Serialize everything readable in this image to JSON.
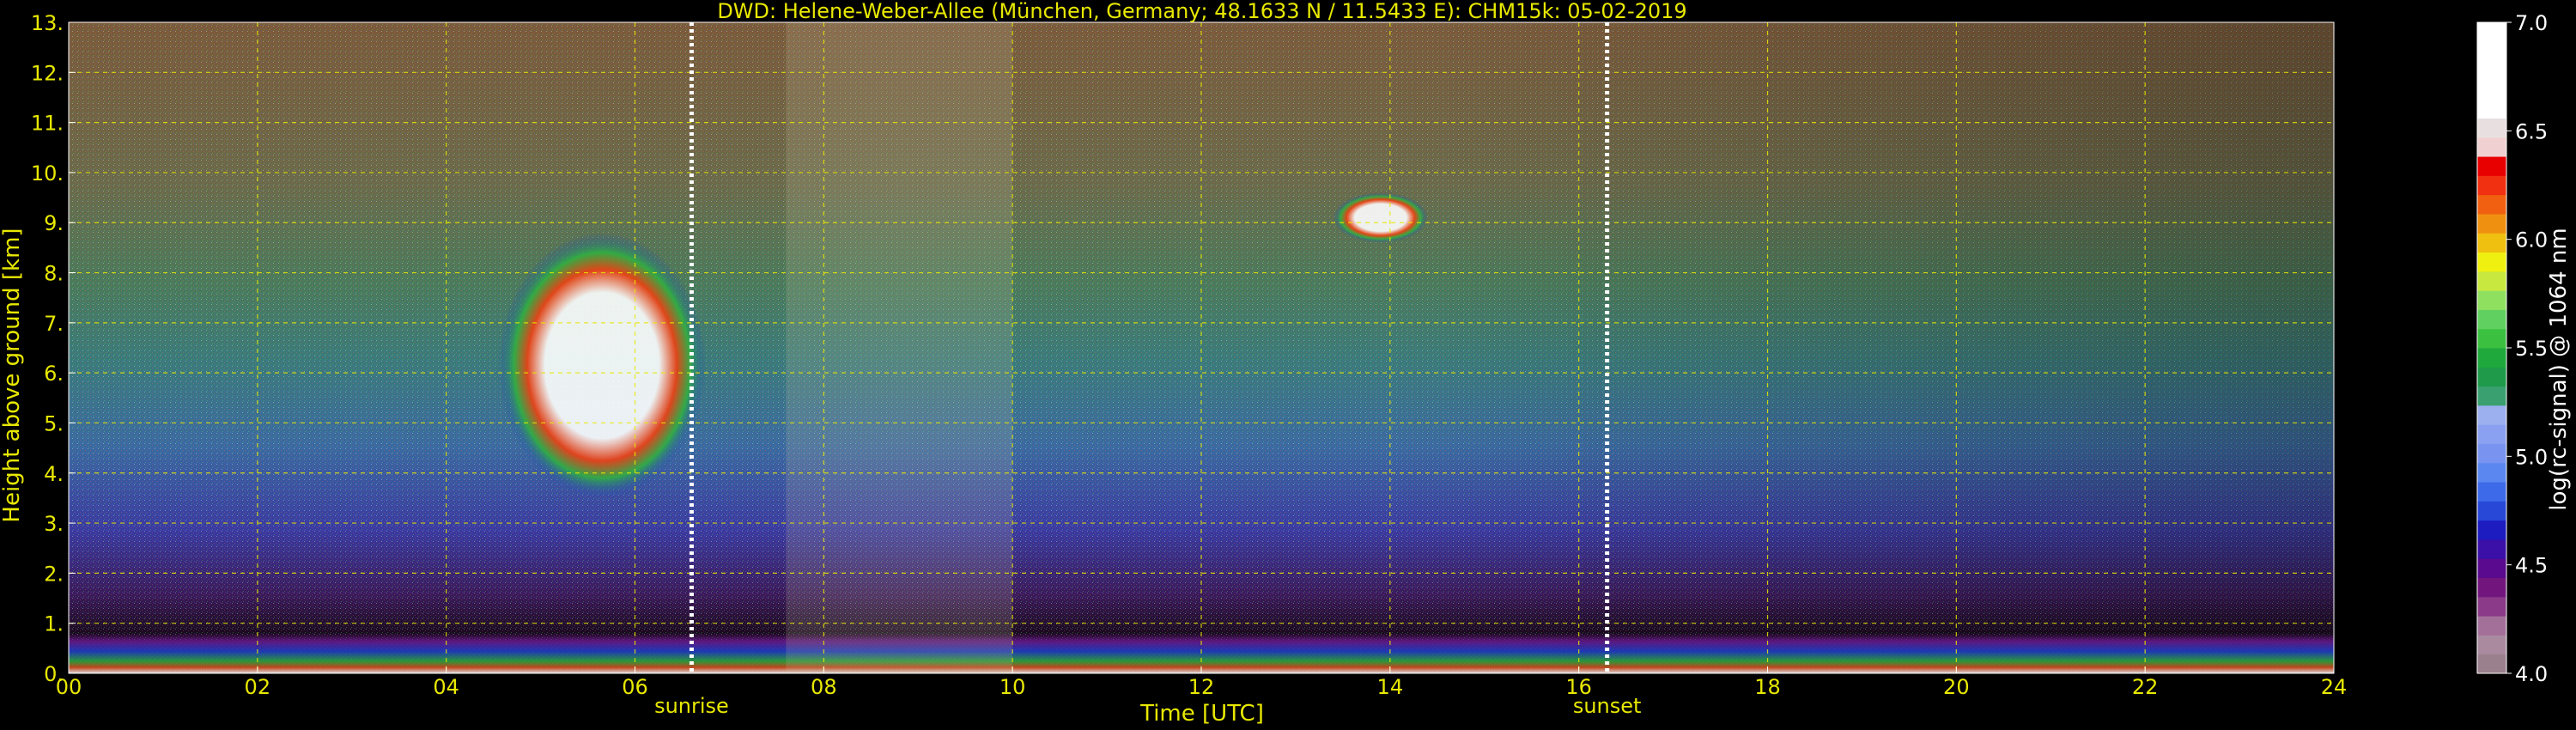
{
  "chart_data": {
    "type": "heatmap",
    "title": "DWD: Helene-Weber-Allee (München, Germany; 48.1633 N / 11.5433 E):    CHM15k: 05-02-2019",
    "xlabel": "Time [UTC]",
    "ylabel": "Height above ground [km]",
    "xlim": [
      0,
      24
    ],
    "ylim": [
      0,
      13
    ],
    "x_ticks": [
      0,
      2,
      4,
      6,
      8,
      10,
      12,
      14,
      16,
      18,
      20,
      22,
      24
    ],
    "x_tick_labels": [
      "00",
      "02",
      "04",
      "06",
      "08",
      "10",
      "12",
      "14",
      "16",
      "18",
      "20",
      "22",
      "24"
    ],
    "y_ticks": [
      0,
      1,
      2,
      3,
      4,
      5,
      6,
      7,
      8,
      9,
      10,
      11,
      12,
      13
    ],
    "y_tick_labels": [
      "0.",
      "1.",
      "2.",
      "3.",
      "4.",
      "5.",
      "6.",
      "7.",
      "8.",
      "9.",
      "10.",
      "11.",
      "12.",
      "13."
    ],
    "grid": true,
    "colorbar": {
      "label": "log(rc-signal) @ 1064 nm",
      "range": [
        4.0,
        7.0
      ],
      "ticks": [
        4.0,
        4.5,
        5.0,
        5.5,
        6.0,
        6.5,
        7.0
      ],
      "tick_labels": [
        "4.0",
        "4.5",
        "5.0",
        "5.5",
        "6.0",
        "6.5",
        "7.0"
      ],
      "colors": [
        "#9a7f8c",
        "#a98a9f",
        "#a3709a",
        "#8a3a88",
        "#72167d",
        "#5a0a8e",
        "#3a10a8",
        "#1c1cc0",
        "#2848d8",
        "#3c6ae8",
        "#5a88f0",
        "#7894f0",
        "#8aa0f0",
        "#9cb0f0",
        "#3aa070",
        "#1e9a4a",
        "#1fa93c",
        "#3cc040",
        "#60d060",
        "#90e060",
        "#c8e840",
        "#f0f010",
        "#f0c010",
        "#f09010",
        "#f06010",
        "#f03010",
        "#e80000",
        "#f0d0d0",
        "#e8e0e0",
        "#ffffff",
        "#ffffff",
        "#ffffff",
        "#ffffff",
        "#ffffff"
      ]
    },
    "markers": [
      {
        "label": "sunrise",
        "x": 6.6
      },
      {
        "label": "sunset",
        "x": 16.3
      }
    ],
    "features": [
      {
        "name": "mid-level cloud",
        "x_range": [
          4.55,
          6.75
        ],
        "y_range": [
          3.5,
          8.8
        ]
      },
      {
        "name": "cirrus",
        "x_range": [
          13.4,
          14.4
        ],
        "y_range": [
          8.6,
          9.6
        ]
      },
      {
        "name": "boundary layer",
        "x_range": [
          0,
          24
        ],
        "y_range": [
          0,
          0.8
        ]
      },
      {
        "name": "precipitation / noise streaks",
        "x_range": [
          7.6,
          10.0
        ],
        "y_range": [
          0,
          13
        ]
      }
    ]
  }
}
